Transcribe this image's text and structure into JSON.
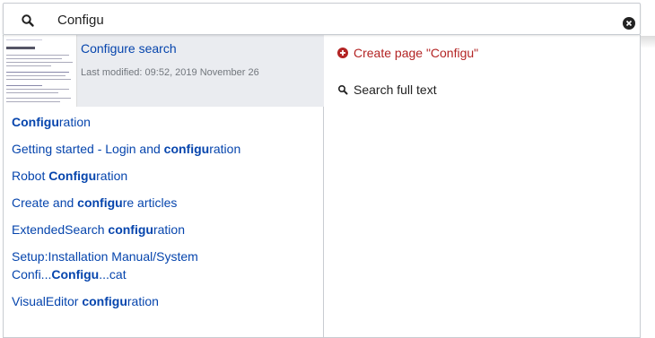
{
  "search": {
    "value": "Configu",
    "icon": "search-icon",
    "clear_icon": "clear-icon"
  },
  "featured": {
    "title": "Configure search",
    "meta": "Last modified: 09:52, 2019 November 26",
    "thumbnail_icon": "page-thumbnail"
  },
  "results": [
    {
      "pre": "",
      "match": "Configu",
      "post": "ration"
    },
    {
      "pre": "Getting started - Login and ",
      "match": "configu",
      "post": "ration"
    },
    {
      "pre": "Robot ",
      "match": "Configu",
      "post": "ration"
    },
    {
      "pre": "Create and ",
      "match": "configu",
      "post": "re articles"
    },
    {
      "pre": "ExtendedSearch ",
      "match": "configu",
      "post": "ration"
    },
    {
      "pre": "Setup:Installation Manual/System Confi...",
      "match": "Configu",
      "post": "...cat"
    },
    {
      "pre": "VisualEditor ",
      "match": "configu",
      "post": "ration"
    }
  ],
  "actions": {
    "create_label": "Create page \"Configu\"",
    "create_icon": "plus-circle-icon",
    "fulltext_label": "Search full text",
    "fulltext_icon": "search-icon"
  },
  "colors": {
    "link": "#0645ad",
    "create": "#b32424",
    "featured_bg": "#eaecf0",
    "border": "#c8ccd1"
  }
}
